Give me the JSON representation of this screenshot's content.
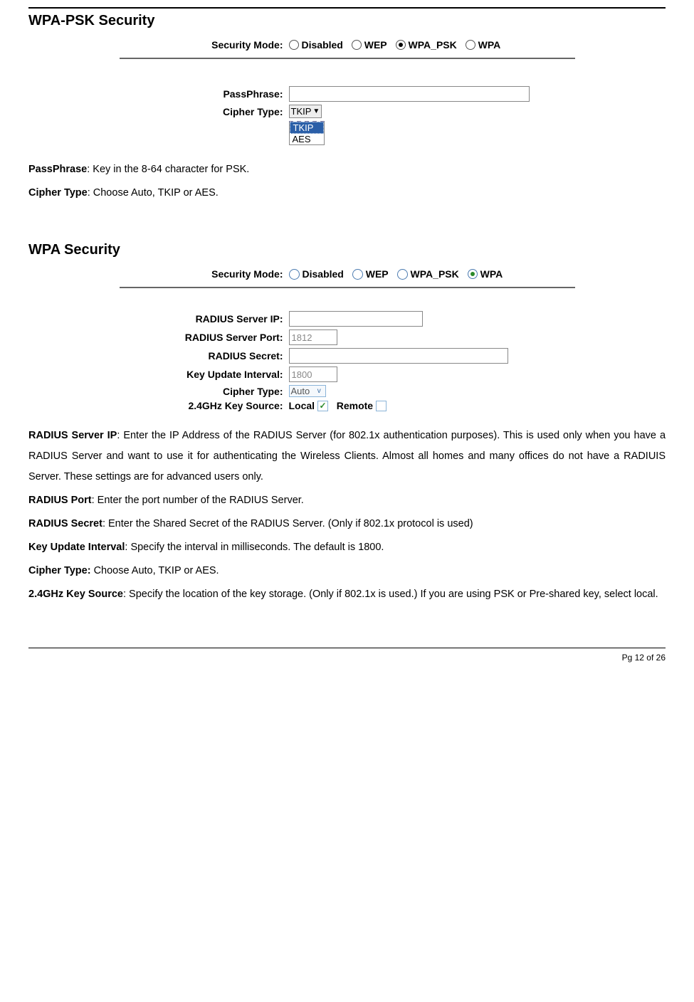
{
  "section1": {
    "title": "WPA-PSK Security",
    "security_mode_label": "Security Mode:",
    "radios": {
      "disabled": "Disabled",
      "wep": "WEP",
      "wpa_psk": "WPA_PSK",
      "wpa": "WPA"
    },
    "passphrase_label": "PassPhrase:",
    "cipher_label": "Cipher Type:",
    "cipher_selected": "TKIP",
    "cipher_options": {
      "tkip": "TKIP",
      "aes": "AES"
    },
    "desc": {
      "passphrase_term": "PassPhrase",
      "passphrase_text": ": Key in the 8-64 character for PSK.",
      "cipher_term": "Cipher Type",
      "cipher_text": ": Choose Auto, TKIP or AES."
    }
  },
  "section2": {
    "title": "WPA Security",
    "security_mode_label": "Security Mode:",
    "radios": {
      "disabled": "Disabled",
      "wep": "WEP",
      "wpa_psk": "WPA_PSK",
      "wpa": "WPA"
    },
    "fields": {
      "radius_ip_label": "RADIUS Server IP:",
      "radius_port_label": "RADIUS Server Port:",
      "radius_port_value": "1812",
      "radius_secret_label": "RADIUS Secret:",
      "key_update_label": "Key Update Interval:",
      "key_update_value": "1800",
      "cipher_label": "Cipher Type:",
      "cipher_selected": "Auto",
      "key_source_label": "2.4GHz Key Source:",
      "local_label": "Local",
      "remote_label": "Remote"
    },
    "desc": {
      "radius_ip_term": "RADIUS Server IP",
      "radius_ip_text": ": Enter the IP Address of the RADIUS Server (for 802.1x authentication purposes). This is used only when you have a RADIUS Server and want to use it for authenticating the Wireless Clients. Almost all homes and many offices do not have a RADIUIS Server. These settings are for advanced users only.",
      "radius_port_term": "RADIUS Port",
      "radius_port_text": ": Enter the port number of the RADIUS Server.",
      "radius_secret_term": "RADIUS Secret",
      "radius_secret_text": ": Enter the Shared Secret of the RADIUS Server. (Only if 802.1x protocol is used)",
      "key_update_term": "Key Update Interval",
      "key_update_text": ": Specify the interval in milliseconds. The default is 1800.",
      "cipher_term": "Cipher Type:",
      "cipher_text": " Choose Auto, TKIP or AES.",
      "key_source_term": "2.4GHz Key Source",
      "key_source_text": ": Specify the location of the key storage. (Only if 802.1x is used.) If you are using PSK or Pre-shared key, select local."
    }
  },
  "footer": "Pg 12 of 26"
}
